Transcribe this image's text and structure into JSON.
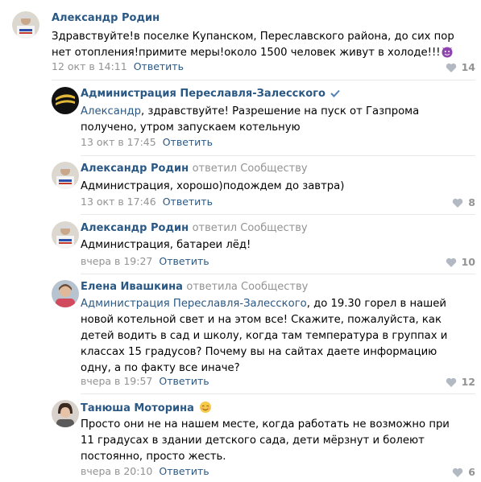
{
  "colors": {
    "link": "#2a5885",
    "muted": "#939393",
    "divider": "#e7e8ec"
  },
  "comments": [
    {
      "author": "Александр Родин",
      "replied_to": "",
      "text": "Здравствуйте!в поселке Купанском, Переславского района, до сих пор нет отопления!примите меры!около 1500 человек живут в холоде!!!",
      "emoji": "devil-emoji",
      "time": "12 окт в 14:11",
      "reply_label": "Ответить",
      "likes": "14"
    },
    {
      "author": "Администрация Переславля-Залесского",
      "verified_icon": "verified-check-icon",
      "mention": "Александр",
      "text": ", здравствуйте! Разрешение на пуск от Газпрома получено, утром запускаем котельную",
      "time": "13 окт в 17:45",
      "reply_label": "Ответить",
      "likes": ""
    },
    {
      "author": "Александр Родин",
      "replied_to": "ответил Сообществу",
      "text": "Администрация, хорошо)подождем до завтра)",
      "time": "13 окт в 17:46",
      "reply_label": "Ответить",
      "likes": "8"
    },
    {
      "author": "Александр Родин",
      "replied_to": "ответил Сообществу",
      "text": "Администрация, батареи лёд!",
      "time": "вчера в 19:27",
      "reply_label": "Ответить",
      "likes": "10"
    },
    {
      "author": "Елена Ивашкина",
      "replied_to": "ответила Сообществу",
      "mention": "Администрация Переславля-Залесского",
      "text": ", до 19.30 горел в нашей новой котельной свет и на этом все! Скажите, пожалуйста, как детей водить в сад и школу, когда там температура в группах и классах 15 градусов? Почему вы на сайтах даете информацию одну, а по факту все иначе?",
      "time": "вчера в 19:57",
      "reply_label": "Ответить",
      "likes": "12"
    },
    {
      "author": "Танюша Моторина",
      "author_emoji": "smiling-face-emoji",
      "text": "Просто они не на нашем месте, когда работать не возможно при 11 градусах в здании детского сада, дети мёрзнут и болеют постоянно, просто жесть.",
      "time": "вчера в 20:10",
      "reply_label": "Ответить",
      "likes": "6"
    }
  ]
}
